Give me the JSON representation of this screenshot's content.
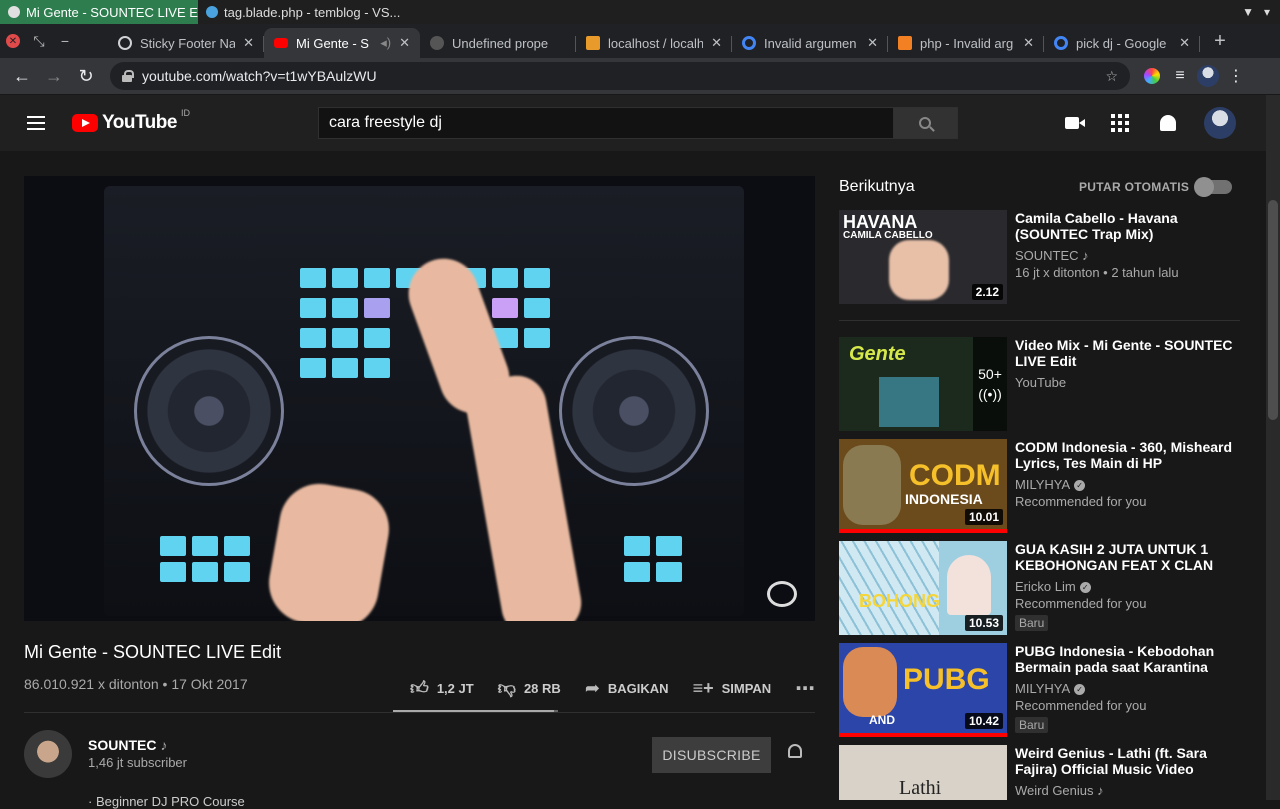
{
  "os": {
    "windows": [
      {
        "title": "Mi Gente - SOUNTEC LIVE E...",
        "active": true
      },
      {
        "title": "tag.blade.php - temblog - VS...",
        "active": false
      }
    ]
  },
  "browser": {
    "tabs": [
      {
        "title": "Sticky Footer Na",
        "favicon_color": "#cfd2d6",
        "active": false
      },
      {
        "title": "Mi Gente - S",
        "favicon_color": "#ff0000",
        "active": true
      },
      {
        "title": "Undefined prope",
        "favicon_color": "#555555",
        "active": false
      },
      {
        "title": "localhost / localh",
        "favicon_color": "#e89b2b",
        "active": false
      },
      {
        "title": "Invalid argumen",
        "favicon_color": "#4285f4",
        "active": false
      },
      {
        "title": "php - Invalid arg",
        "favicon_color": "#f48024",
        "active": false
      },
      {
        "title": "pick dj - Google",
        "favicon_color": "#4285f4",
        "active": false
      }
    ],
    "url": "youtube.com/watch?v=t1wYBAulzWU"
  },
  "yt": {
    "wordmark": "YouTube",
    "region": "ID",
    "search_value": "cara freestyle dj"
  },
  "video": {
    "title": "Mi Gente - SOUNTEC LIVE Edit",
    "stats": "86.010.921 x ditonton • 17 Okt 2017",
    "likes": "1,2 JT",
    "dislikes": "28 RB",
    "share_label": "BAGIKAN",
    "save_label": "SIMPAN",
    "like_ratio": 0.977
  },
  "owner": {
    "name": "SOUNTEC",
    "note_icon": "♪",
    "subscribers": "1,46 jt subscriber",
    "unsubscribe_label": "DISUBSCRIBE",
    "description_peek": "· Beginner DJ PRO Course"
  },
  "sidebar": {
    "up_next_label": "Berikutnya",
    "autoplay_label": "PUTAR OTOMATIS",
    "recommendations": [
      {
        "title": "Camila Cabello - Havana (SOUNTEC Trap Mix)",
        "channel": "SOUNTEC ♪",
        "meta": "16 jt x ditonton • 2 tahun lalu",
        "duration": "2.12",
        "thumb_text": "HAVANA",
        "thumb_sub": "CAMILA CABELLO",
        "thumb_color": "#2a2a2e"
      },
      {
        "title": "Video Mix - Mi Gente - SOUNTEC LIVE Edit",
        "channel": "YouTube",
        "meta": "",
        "count": "50+",
        "thumb_text": "Gente",
        "thumb_color": "#1c2a1e"
      },
      {
        "title": "CODM Indonesia - 360, Misheard Lyrics, Tes Main di HP",
        "channel": "MILYHYA",
        "meta": "Recommended for you",
        "duration": "10.01",
        "thumb_text": "CODM",
        "thumb_sub": "INDONESIA",
        "thumb_color": "#6b4a1c"
      },
      {
        "title": "GUA KASIH 2 JUTA UNTUK 1 KEBOHONGAN FEAT X CLAN",
        "channel": "Ericko Lim",
        "meta": "Recommended for you",
        "badge": "Baru",
        "duration": "10.53",
        "thumb_text": "BOHONG",
        "thumb_color": "#9ecfe0"
      },
      {
        "title": "PUBG Indonesia - Kebodohan Bermain pada saat Karantina",
        "channel": "MILYHYA",
        "meta": "Recommended for you",
        "badge": "Baru",
        "duration": "10.42",
        "thumb_text": "PUBG",
        "thumb_sub": "AND",
        "thumb_color": "#2b45a8"
      },
      {
        "title": "Weird Genius - Lathi (ft. Sara Fajira) Official Music Video",
        "channel": "Weird Genius ♪",
        "meta": "",
        "thumb_text": "Lathi",
        "thumb_color": "#d8d2c8"
      }
    ]
  }
}
